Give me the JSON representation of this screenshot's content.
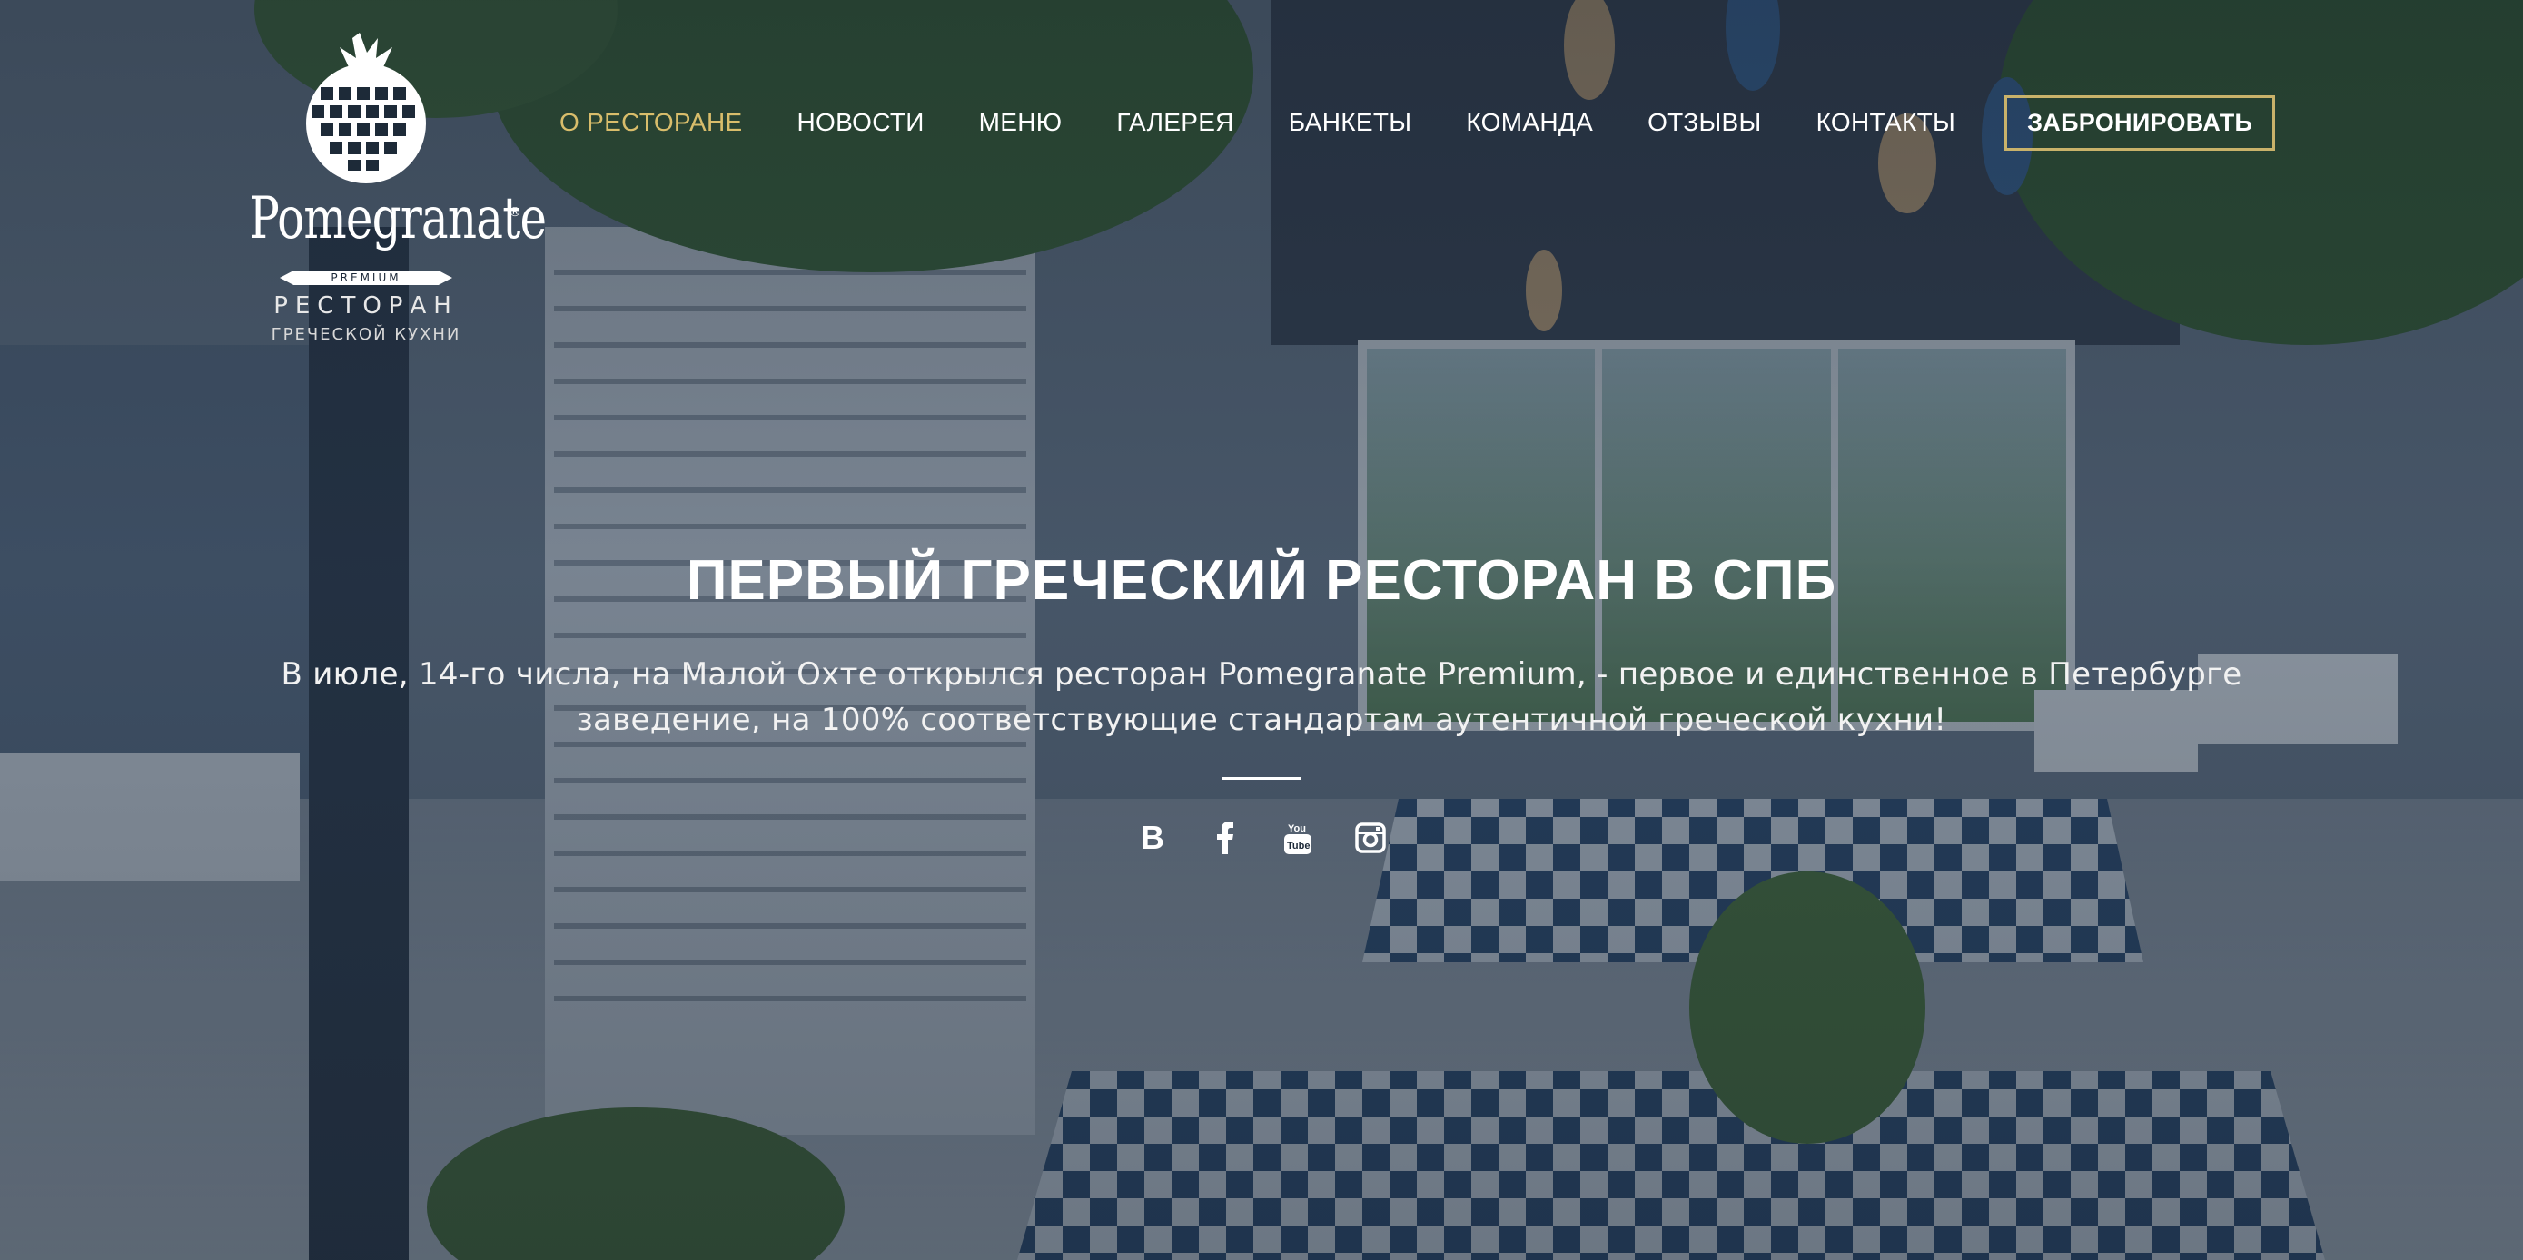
{
  "brand": {
    "wordmark": "Pomegranate",
    "registered": "®",
    "premium": "PREMIUM",
    "line1": "РЕСТОРАН",
    "line2": "ГРЕЧЕСКОЙ КУХНИ"
  },
  "nav": {
    "items": [
      {
        "label": "О РЕСТОРАНЕ",
        "active": true
      },
      {
        "label": "НОВОСТИ"
      },
      {
        "label": "МЕНЮ"
      },
      {
        "label": "ГАЛЕРЕЯ"
      },
      {
        "label": "БАНКЕТЫ"
      },
      {
        "label": "КОМАНДА"
      },
      {
        "label": "ОТЗЫВЫ"
      },
      {
        "label": "КОНТАКТЫ"
      }
    ],
    "book_label": "ЗАБРОНИРОВАТЬ"
  },
  "hero": {
    "title": "ПЕРВЫЙ ГРЕЧЕСКИЙ РЕСТОРАН В СПБ",
    "lead": "В июле, 14-го числа, на Малой Охте открылся ресторан Pomegranate Premium, - первое и единственное в Петербурге заведение, на 100% соответствующие стандартам аутентичной греческой кухни!"
  },
  "social": [
    {
      "icon": "vk-icon",
      "glyph": "B"
    },
    {
      "icon": "facebook-icon"
    },
    {
      "icon": "youtube-icon"
    },
    {
      "icon": "instagram-icon"
    }
  ],
  "colors": {
    "accent_gold": "#d9bd6b",
    "button_border": "#c9b26a",
    "text": "#ffffff"
  }
}
